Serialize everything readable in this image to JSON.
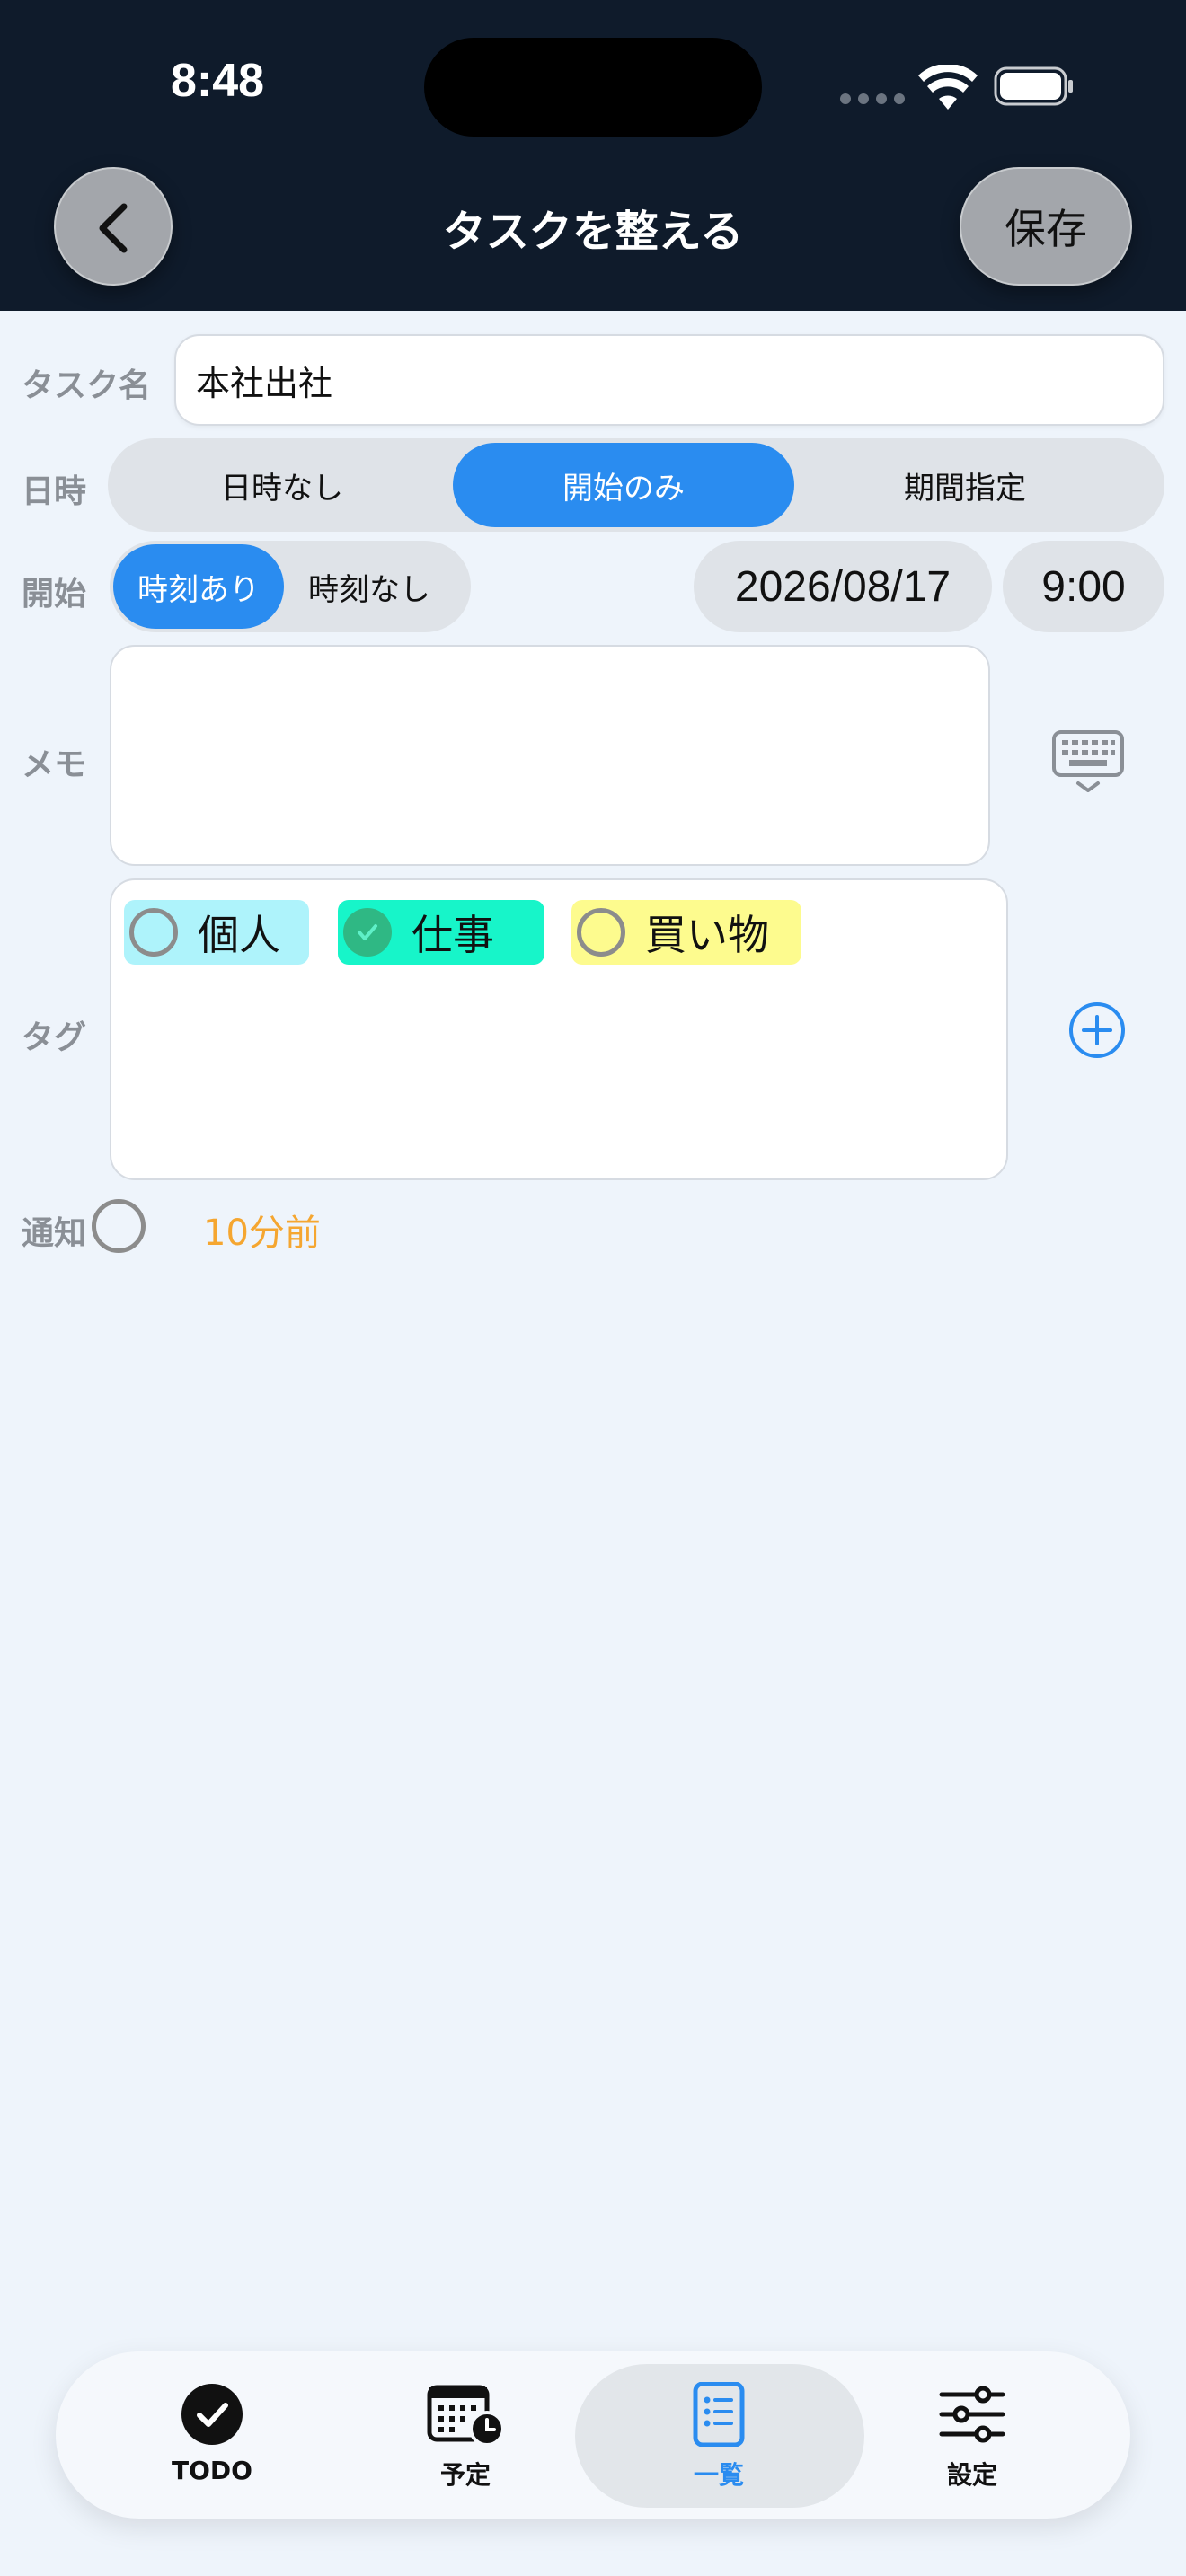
{
  "status_bar": {
    "time": "8:48"
  },
  "header": {
    "title": "タスクを整える",
    "save_label": "保存"
  },
  "form": {
    "task_name_label": "タスク名",
    "task_name_value": "本社出社",
    "datetime_label": "日時",
    "datetime_options": [
      "日時なし",
      "開始のみ",
      "期間指定"
    ],
    "datetime_selected": "開始のみ",
    "start_label": "開始",
    "time_options": [
      "時刻あり",
      "時刻なし"
    ],
    "time_selected": "時刻あり",
    "start_date": "2026/08/17",
    "start_time": "9:00",
    "memo_label": "メモ",
    "memo_value": "",
    "tag_label": "タグ",
    "tags": [
      {
        "name": "個人",
        "color": "#aef3fb",
        "checked": false
      },
      {
        "name": "仕事",
        "color": "#17f5c9",
        "checked": true
      },
      {
        "name": "買い物",
        "color": "#fdfb8e",
        "checked": false
      }
    ],
    "notify_label": "通知",
    "notify_enabled": false,
    "notify_value": "10分前"
  },
  "tabbar": {
    "items": [
      {
        "label": "TODO",
        "icon": "checkmark-circle-icon"
      },
      {
        "label": "予定",
        "icon": "calendar-clock-icon"
      },
      {
        "label": "一覧",
        "icon": "list-icon"
      },
      {
        "label": "設定",
        "icon": "sliders-icon"
      }
    ],
    "active": "一覧"
  },
  "colors": {
    "accent": "#2a8cf0",
    "header_bg": "#0f1b2b",
    "notify_text": "#f5a630"
  }
}
